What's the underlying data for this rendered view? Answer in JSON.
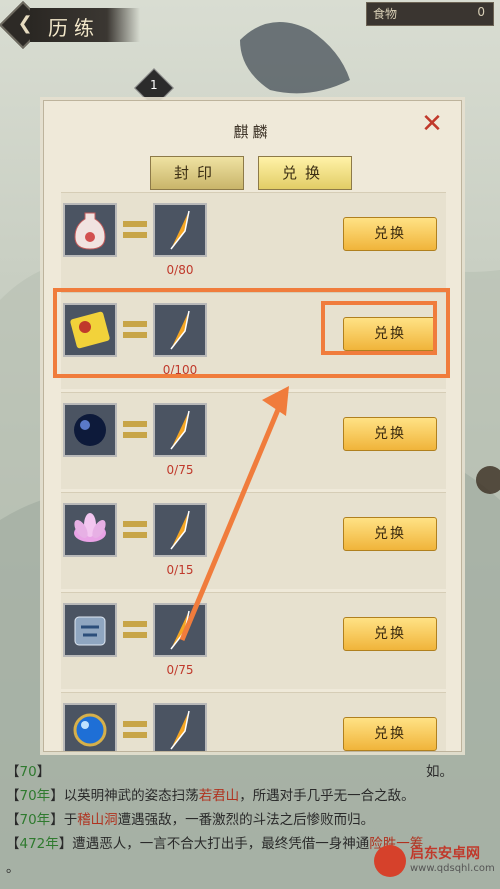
{
  "header": {
    "title": "历练",
    "back_label": "❮",
    "food_label": "食物",
    "food_value": "0"
  },
  "level_badge": "1",
  "panel": {
    "title": "麒麟",
    "close_label": "✕",
    "tabs": [
      {
        "label": "封印"
      },
      {
        "label": "兑换"
      }
    ],
    "rows": [
      {
        "item_icon": "vase-icon",
        "reward_icon": "feather-icon",
        "count": "0/80",
        "button": "兑换"
      },
      {
        "item_icon": "scroll-icon",
        "reward_icon": "feather-icon",
        "count": "0/100",
        "button": "兑换"
      },
      {
        "item_icon": "dark-orb-icon",
        "reward_icon": "feather-icon",
        "count": "0/75",
        "button": "兑换"
      },
      {
        "item_icon": "lotus-icon",
        "reward_icon": "feather-icon",
        "count": "0/15",
        "button": "兑换"
      },
      {
        "item_icon": "jade-token-icon",
        "reward_icon": "feather-icon",
        "count": "0/75",
        "button": "兑换"
      },
      {
        "item_icon": "blue-orb-icon",
        "reward_icon": "feather-icon",
        "count": "",
        "button": "兑换"
      }
    ]
  },
  "log": [
    {
      "year": "70",
      "text": "",
      "tail": "如。"
    },
    {
      "year": "70年",
      "pre": "以英明神武的姿态扫荡",
      "place": "若君山",
      "post": "，所遇对手几乎无一合之敌。"
    },
    {
      "year": "70年",
      "pre": "于",
      "place": "稽山洞",
      "post": "遭遇强敌，一番激烈的斗法之后惨败而归。"
    },
    {
      "year": "472年",
      "pre": "遭遇恶人，一言不合大打出手，最终凭借一身神通",
      "place": "险胜一筹",
      "post": ""
    },
    {
      "year": "",
      "pre": "。",
      "place": "",
      "post": ""
    }
  ],
  "colors": {
    "accent": "#f07c3c",
    "count_red": "#c0392b",
    "button_gold": "#f0b43a"
  },
  "watermark": {
    "name": "启东安卓网",
    "url": "www.qdsqhl.com"
  }
}
